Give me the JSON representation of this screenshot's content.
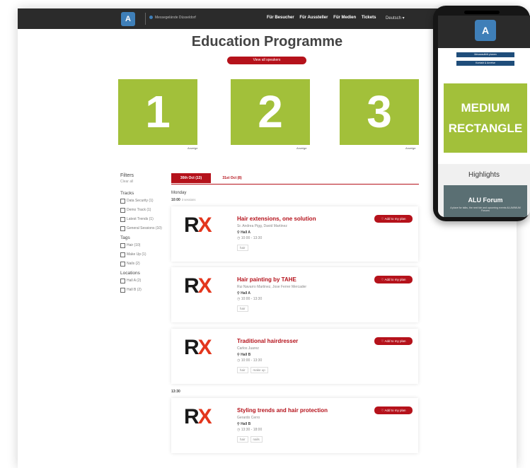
{
  "header": {
    "logo_text": "A",
    "brand": "Messegelände Düsseldorf",
    "nav": [
      "Für Besucher",
      "Für Aussteller",
      "Für Medien",
      "Tickets"
    ],
    "language": "Deutsch ▾"
  },
  "page": {
    "title": "Education Programme",
    "view_speakers": "View all speakers"
  },
  "ads": [
    {
      "number": "1",
      "label": "Anzeige"
    },
    {
      "number": "2",
      "label": "Anzeige"
    },
    {
      "number": "3",
      "label": "Anzeige"
    }
  ],
  "filters": {
    "title": "Filters",
    "clear": "Clear all",
    "tracks_title": "Tracks",
    "tracks": [
      "Data Security (1)",
      "Demo Track (1)",
      "Latest Trends (1)",
      "General Sessions (10)"
    ],
    "tags_title": "Tags",
    "tags": [
      "Hair (10)",
      "Make Up (1)",
      "Nails (2)"
    ],
    "locations_title": "Locations",
    "locations": [
      "Hall A (2)",
      "Hall B (2)"
    ]
  },
  "tabs": [
    "30th Oct (13)",
    "31st Oct (8)"
  ],
  "schedule": {
    "day": "Monday",
    "time1": "10:00",
    "time1_count": "3 sessions",
    "time2": "13:30",
    "sessions": [
      {
        "title": "Hair extensions, one solution",
        "speakers": "Sr. Andrea Pigg, David Martinez",
        "hall": "Hall A",
        "time": "10:00 - 13:30",
        "tags": [
          "hair"
        ]
      },
      {
        "title": "Hair painting by TAHE",
        "speakers": "Rui Navarro Martinez, Jose Ferrer Mercader",
        "hall": "Hall A",
        "time": "10:00 - 13:30",
        "tags": [
          "hair"
        ]
      },
      {
        "title": "Traditional hairdresser",
        "speakers": "Carlos Juarez",
        "hall": "Hall B",
        "time": "10:00 - 13:30",
        "tags": [
          "hair",
          "make up"
        ]
      },
      {
        "title": "Styling trends and hair protection",
        "speakers": "Gerardo Cerro",
        "hall": "Hall B",
        "time": "13:30 - 18:00",
        "tags": [
          "hair",
          "nails"
        ]
      }
    ],
    "add_label": "Add to my plan",
    "logo_r": "R",
    "logo_x": "X"
  },
  "mobile": {
    "logo_text": "A",
    "btn1": "Messeauftritt planen",
    "btn2": "Kontakt & Anreise",
    "ad_line1": "MEDIUM",
    "ad_line2": "RECTANGLE",
    "highlights": "Highlights",
    "alu_title": "ALU Forum",
    "alu_sub": "A place for talks, the next fair and upcoming events ALUMINIUM Forums"
  },
  "colors": {
    "brand_red": "#b5121b",
    "ad_green": "#a2c03a",
    "topbar": "#2b2b2b"
  }
}
